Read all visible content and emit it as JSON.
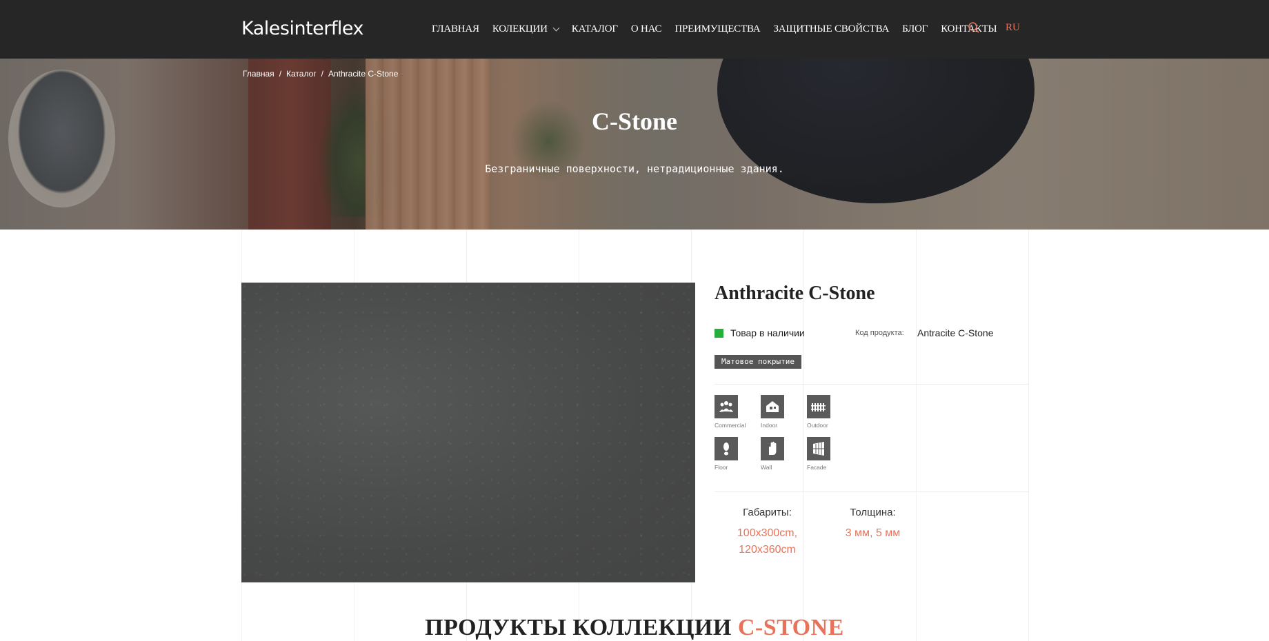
{
  "header": {
    "logo": "Kalesinterflex",
    "nav": [
      {
        "label": "ГЛАВНАЯ"
      },
      {
        "label": "КОЛЕКЦИИ",
        "dropdown": true
      },
      {
        "label": "КАТАЛОГ"
      },
      {
        "label": "О НАС"
      },
      {
        "label": "ПРЕИМУЩЕСТВА"
      },
      {
        "label": "ЗАЩИТНЫЕ СВОЙСТВА"
      },
      {
        "label": "БЛОГ"
      },
      {
        "label": "КОНТАКТЫ"
      }
    ],
    "search_icon": "search-icon",
    "lang": "RU"
  },
  "breadcrumb": [
    "Главная",
    "Каталог",
    "Anthracite C-Stone"
  ],
  "hero": {
    "title": "C-Stone",
    "subtitle": "Безграничные поверхности, нетрадиционные здания."
  },
  "product": {
    "title": "Anthracite C-Stone",
    "stock": "Товар в наличии",
    "code_label": "Код продукта:",
    "code_value": "Antracite C-Stone",
    "finish": "Матовое покрытие",
    "usage": [
      {
        "label": "Commercial",
        "icon": "people-icon"
      },
      {
        "label": "Indoor",
        "icon": "house-icon"
      },
      {
        "label": "Outdoor",
        "icon": "fence-icon"
      },
      {
        "label": "Floor",
        "icon": "footprint-icon"
      },
      {
        "label": "Wall",
        "icon": "hand-icon"
      },
      {
        "label": "Facade",
        "icon": "facade-icon"
      }
    ],
    "specs": [
      {
        "label": "Габариты:",
        "value": "100x300cm, 120x360cm"
      },
      {
        "label": "Толщина:",
        "value": "3 мм, 5 мм"
      }
    ]
  },
  "section": {
    "title_main": "ПРОДУКТЫ КОЛЛЕКЦИИ ",
    "title_accent": "C-STONE"
  },
  "colors": {
    "header_bg": "#262626",
    "accent": "#e8735a",
    "in_stock": "#22b03a"
  }
}
